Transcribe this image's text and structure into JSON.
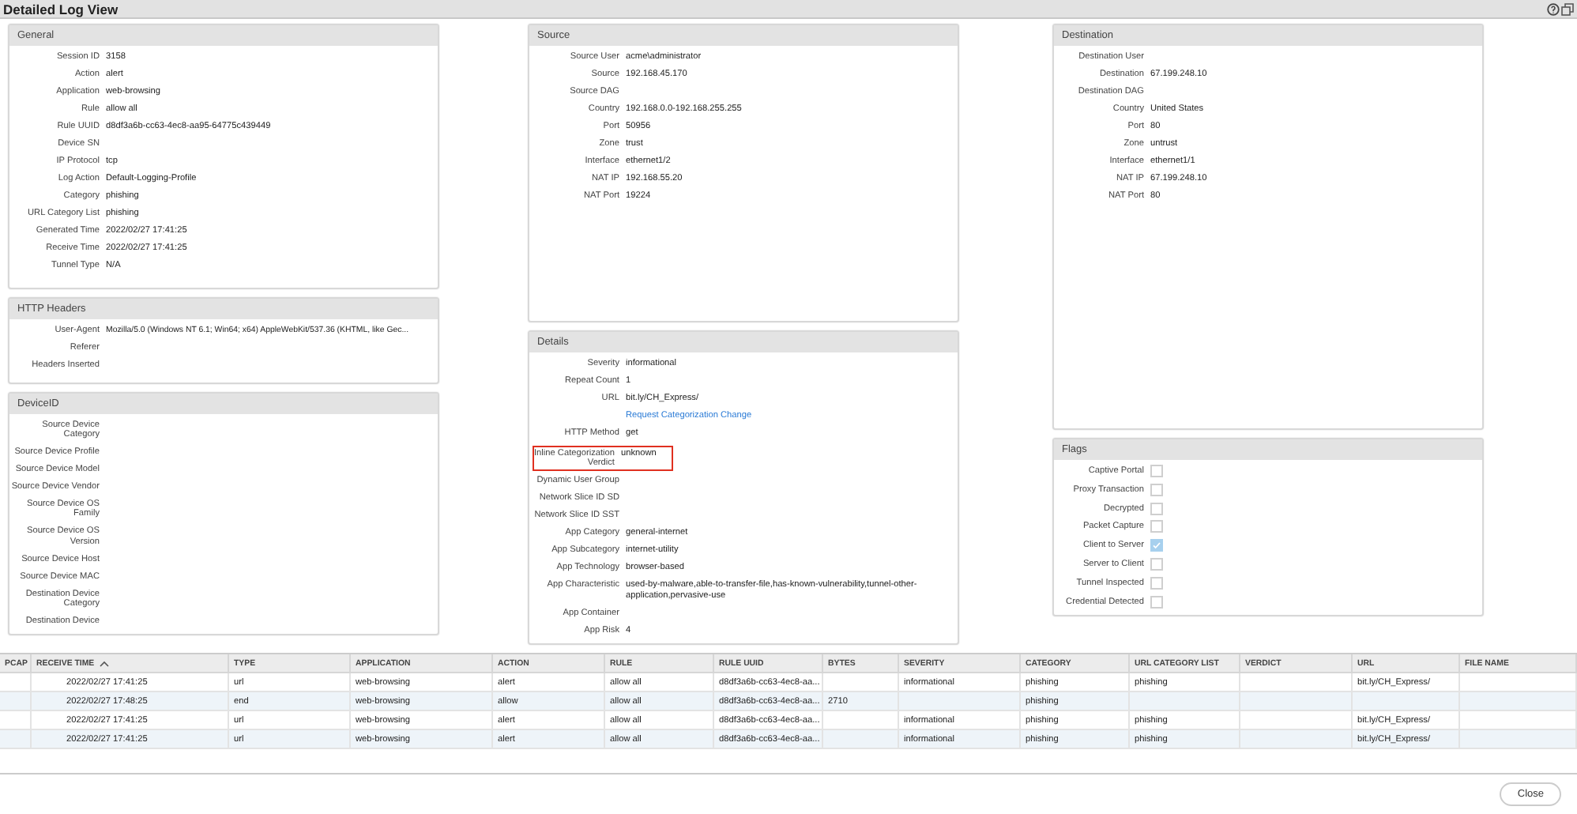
{
  "window": {
    "title": "Detailed Log View"
  },
  "columns": [
    [
      {
        "title": "General",
        "rows": [
          {
            "kind": "field",
            "label": "Session ID",
            "value": "3158"
          },
          {
            "kind": "field",
            "label": "Action",
            "value": "alert"
          },
          {
            "kind": "field",
            "label": "Application",
            "value": "web-browsing"
          },
          {
            "kind": "field",
            "label": "Rule",
            "value": "allow all"
          },
          {
            "kind": "field",
            "label": "Rule UUID",
            "value": "d8df3a6b-cc63-4ec8-aa95-64775c439449"
          },
          {
            "kind": "field",
            "label": "Device SN"
          },
          {
            "kind": "field",
            "label": "IP Protocol",
            "value": "tcp"
          },
          {
            "kind": "field",
            "label": "Log Action",
            "value": "Default-Logging-Profile"
          },
          {
            "kind": "field",
            "label": "Category",
            "value": "phishing"
          },
          {
            "kind": "field",
            "label": "URL Category List",
            "value": "phishing"
          },
          {
            "kind": "field",
            "label": "Generated Time",
            "value": "2022/02/27 17:41:25"
          },
          {
            "kind": "field",
            "label": "Receive Time",
            "value": "2022/02/27 17:41:25"
          },
          {
            "kind": "field",
            "label": "Tunnel Type",
            "value": "N/A"
          }
        ]
      },
      {
        "title": "HTTP Headers",
        "rows": [
          {
            "kind": "field",
            "label": "User-Agent",
            "value": "Mozilla/5.0 (Windows NT 6.1; Win64; x64) AppleWebKit/537.36 (KHTML, like Gec..."
          },
          {
            "kind": "field",
            "label": "Referer"
          },
          {
            "kind": "field",
            "label": "Headers Inserted"
          }
        ]
      },
      {
        "title": "DeviceID",
        "rows": [
          {
            "kind": "field",
            "label": "Source Device Category"
          },
          {
            "kind": "field",
            "label": "Source Device Profile"
          },
          {
            "kind": "field",
            "label": "Source Device Model"
          },
          {
            "kind": "field",
            "label": "Source Device Vendor"
          },
          {
            "kind": "field",
            "label": "Source Device OS Family"
          },
          {
            "kind": "field",
            "label": "Source Device OS Version"
          },
          {
            "kind": "field",
            "label": "Source Device Host"
          },
          {
            "kind": "field",
            "label": "Source Device MAC"
          },
          {
            "kind": "field",
            "label": "Destination Device Category"
          },
          {
            "kind": "field",
            "label": "Destination Device"
          }
        ]
      }
    ],
    [
      {
        "title": "Source",
        "rows": [
          {
            "kind": "field",
            "label": "Source User",
            "value": "acme\\administrator"
          },
          {
            "kind": "field",
            "label": "Source",
            "value": "192.168.45.170"
          },
          {
            "kind": "field",
            "label": "Source DAG"
          },
          {
            "kind": "field",
            "label": "Country",
            "value": "192.168.0.0-192.168.255.255"
          },
          {
            "kind": "field",
            "label": "Port",
            "value": "50956"
          },
          {
            "kind": "field",
            "label": "Zone",
            "value": "trust"
          },
          {
            "kind": "field",
            "label": "Interface",
            "value": "ethernet1/2"
          },
          {
            "kind": "field",
            "label": "NAT IP",
            "value": "192.168.55.20"
          },
          {
            "kind": "field",
            "label": "NAT Port",
            "value": "19224"
          }
        ]
      },
      {
        "title": "Details",
        "rows": [
          {
            "kind": "field",
            "label": "Severity",
            "value": "informational"
          },
          {
            "kind": "field",
            "label": "Repeat Count",
            "value": "1"
          },
          {
            "kind": "field",
            "label": "URL",
            "value": "bit.ly/CH_Express/"
          },
          {
            "kind": "link",
            "value": "Request Categorization Change"
          },
          {
            "kind": "field",
            "label": "HTTP Method",
            "value": "get"
          },
          {
            "kind": "field",
            "label": "Inline Categorization Verdict",
            "value": "unknown",
            "highlighted": true
          },
          {
            "kind": "field",
            "label": "Dynamic User Group"
          },
          {
            "kind": "field",
            "label": "Network Slice ID SD"
          },
          {
            "kind": "field",
            "label": "Network Slice ID SST"
          },
          {
            "kind": "field",
            "label": "App Category",
            "value": "general-internet"
          },
          {
            "kind": "field",
            "label": "App Subcategory",
            "value": "internet-utility"
          },
          {
            "kind": "field",
            "label": "App Technology",
            "value": "browser-based"
          },
          {
            "kind": "field",
            "label": "App Characteristic",
            "value": "used-by-malware,able-to-transfer-file,has-known-vulnerability,tunnel-other-application,pervasive-use"
          },
          {
            "kind": "field",
            "label": "App Container"
          },
          {
            "kind": "field",
            "label": "App Risk",
            "value": "4"
          }
        ]
      }
    ],
    [
      {
        "title": "Destination",
        "rows": [
          {
            "kind": "field",
            "label": "Destination User"
          },
          {
            "kind": "field",
            "label": "Destination",
            "value": "67.199.248.10"
          },
          {
            "kind": "field",
            "label": "Destination DAG"
          },
          {
            "kind": "field",
            "label": "Country",
            "value": "United States"
          },
          {
            "kind": "field",
            "label": "Port",
            "value": "80"
          },
          {
            "kind": "field",
            "label": "Zone",
            "value": "untrust"
          },
          {
            "kind": "field",
            "label": "Interface",
            "value": "ethernet1/1"
          },
          {
            "kind": "field",
            "label": "NAT IP",
            "value": "67.199.248.10"
          },
          {
            "kind": "field",
            "label": "NAT Port",
            "value": "80"
          }
        ]
      },
      {
        "title": "Flags",
        "rows": [
          {
            "kind": "flag",
            "label": "Captive Portal",
            "checked": false
          },
          {
            "kind": "flag",
            "label": "Proxy Transaction",
            "checked": false
          },
          {
            "kind": "flag",
            "label": "Decrypted",
            "checked": false
          },
          {
            "kind": "flag",
            "label": "Packet Capture",
            "checked": false
          },
          {
            "kind": "flag",
            "label": "Client to Server",
            "checked": true
          },
          {
            "kind": "flag",
            "label": "Server to Client",
            "checked": false
          },
          {
            "kind": "flag",
            "label": "Tunnel Inspected",
            "checked": false
          },
          {
            "kind": "flag",
            "label": "Credential Detected",
            "checked": false
          }
        ]
      }
    ]
  ],
  "table": {
    "columns": [
      {
        "label": "PCAP"
      },
      {
        "label": "RECEIVE TIME",
        "sorted": true
      },
      {
        "label": "TYPE"
      },
      {
        "label": "APPLICATION"
      },
      {
        "label": "ACTION"
      },
      {
        "label": "RULE"
      },
      {
        "label": "RULE UUID"
      },
      {
        "label": "BYTES"
      },
      {
        "label": "SEVERITY"
      },
      {
        "label": "CATEGORY"
      },
      {
        "label": "URL CATEGORY LIST"
      },
      {
        "label": "VERDICT"
      },
      {
        "label": "URL"
      },
      {
        "label": "FILE NAME"
      }
    ],
    "rows": [
      [
        "",
        "2022/02/27 17:41:25",
        "url",
        "web-browsing",
        "alert",
        "allow all",
        "d8df3a6b-cc63-4ec8-aa...",
        "",
        "informational",
        "phishing",
        "phishing",
        "",
        "bit.ly/CH_Express/",
        ""
      ],
      [
        "",
        "2022/02/27 17:48:25",
        "end",
        "web-browsing",
        "allow",
        "allow all",
        "d8df3a6b-cc63-4ec8-aa...",
        "2710",
        "",
        "phishing",
        "",
        "",
        "",
        ""
      ],
      [
        "",
        "2022/02/27 17:41:25",
        "url",
        "web-browsing",
        "alert",
        "allow all",
        "d8df3a6b-cc63-4ec8-aa...",
        "",
        "informational",
        "phishing",
        "phishing",
        "",
        "bit.ly/CH_Express/",
        ""
      ],
      [
        "",
        "2022/02/27 17:41:25",
        "url",
        "web-browsing",
        "alert",
        "allow all",
        "d8df3a6b-cc63-4ec8-aa...",
        "",
        "informational",
        "phishing",
        "phishing",
        "",
        "bit.ly/CH_Express/",
        ""
      ]
    ]
  },
  "buttons": [
    {
      "label": "Close"
    }
  ]
}
